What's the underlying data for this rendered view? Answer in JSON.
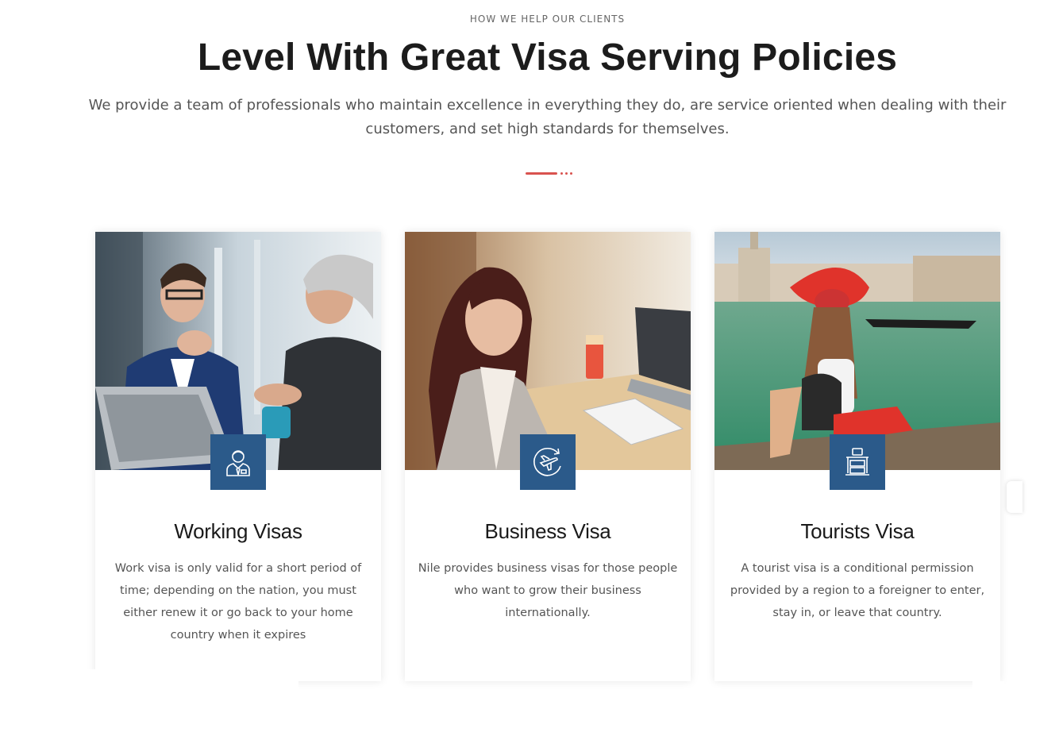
{
  "header": {
    "eyebrow": "HOW WE HELP OUR CLIENTS",
    "title": "Level With Great Visa Serving Policies",
    "lead": "We provide a team of professionals who maintain excellence in everything they do, are service oriented when dealing with their customers, and set high standards for themselves."
  },
  "accent_color": "#d9534f",
  "badge_color": "#2b5a8a",
  "cards": [
    {
      "title": "Working Visas",
      "text": "Work visa is only valid for a short period of time; depending on the nation, you must either renew it or go back to your home country when it expires",
      "icon": "businessman-icon",
      "photo": "office-meeting-photo"
    },
    {
      "title": "Business Visa",
      "text": "Nile provides business visas for those people who want to grow their business internationally.",
      "icon": "airplane-globe-icon",
      "photo": "businesswoman-desk-photo"
    },
    {
      "title": "Tourists Visa",
      "text": "A tourist visa is a conditional permission provided by a region to a foreigner to enter, stay in, or leave that country.",
      "icon": "luggage-cart-icon",
      "photo": "venice-tourist-photo"
    }
  ]
}
